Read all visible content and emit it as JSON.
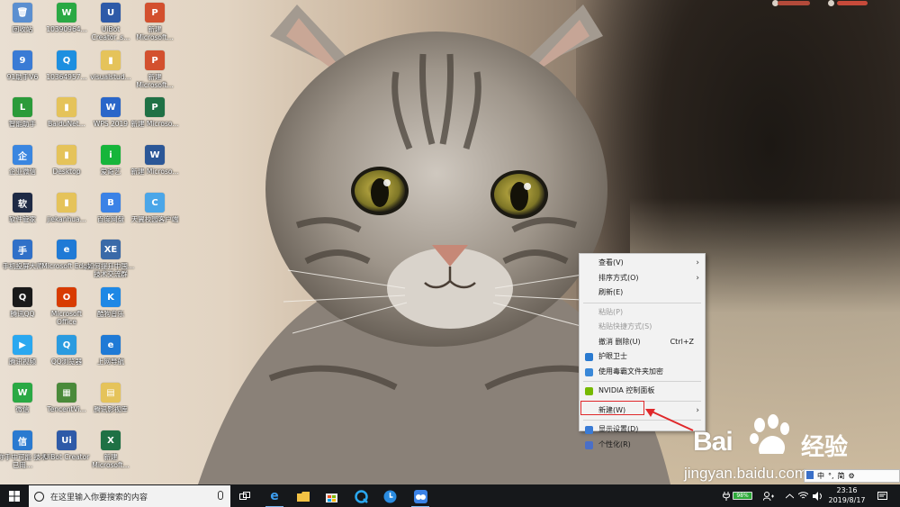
{
  "desktop_icons": [
    {
      "label": "回收站",
      "color": "#5b8fd0",
      "glyph": "🗑",
      "icon": "recycle-bin-icon"
    },
    {
      "label": "10390964...",
      "color": "#2aa944",
      "glyph": "W",
      "icon": "wechat-icon"
    },
    {
      "label": "UiBot Creator_s...",
      "color": "#2e5aa8",
      "glyph": "U",
      "icon": "uibot-icon"
    },
    {
      "label": "新建 Microsoft...",
      "color": "#d3502e",
      "glyph": "P",
      "icon": "powerpoint-file-icon"
    },
    {
      "label": "91助手V6",
      "color": "#3a7bd5",
      "glyph": "9",
      "icon": "91-assistant-icon"
    },
    {
      "label": "10364957...",
      "color": "#1d8fe0",
      "glyph": "Q",
      "icon": "qq-file-icon"
    },
    {
      "label": "visualstud...",
      "color": "#e5c35a",
      "glyph": "▮",
      "icon": "folder-icon"
    },
    {
      "label": "新建 Microsoft...",
      "color": "#d3502e",
      "glyph": "P",
      "icon": "powerpoint-file-icon"
    },
    {
      "label": "智能助手",
      "color": "#2b9b3a",
      "glyph": "L",
      "icon": "helper-icon"
    },
    {
      "label": "BaiduNet...",
      "color": "#e5c35a",
      "glyph": "▮",
      "icon": "folder-icon"
    },
    {
      "label": "WPS 2019",
      "color": "#2a66c9",
      "glyph": "W",
      "icon": "wps-icon"
    },
    {
      "label": "新建 Microso...",
      "color": "#1f7145",
      "glyph": "P",
      "icon": "publisher-file-icon"
    },
    {
      "label": "企业微信",
      "color": "#3a86e0",
      "glyph": "企",
      "icon": "wecom-icon"
    },
    {
      "label": "Desktop",
      "color": "#e5c35a",
      "glyph": "▮",
      "icon": "folder-icon"
    },
    {
      "label": "爱奇艺",
      "color": "#16b53a",
      "glyph": "i",
      "icon": "iqiyi-icon"
    },
    {
      "label": "新建 Microso...",
      "color": "#2b5797",
      "glyph": "W",
      "icon": "word-file-icon"
    },
    {
      "label": "软件管家",
      "color": "#1e2a45",
      "glyph": "软",
      "icon": "software-manager-icon"
    },
    {
      "label": "jiekanhua...",
      "color": "#e5c35a",
      "glyph": "▮",
      "icon": "folder-icon"
    },
    {
      "label": "百度网盘",
      "color": "#3b82e6",
      "glyph": "B",
      "icon": "baidu-netdisk-icon"
    },
    {
      "label": "天翼校园客户端",
      "color": "#4aa6e8",
      "glyph": "C",
      "icon": "campus-client-icon"
    },
    {
      "label": "手机投屏大师",
      "color": "#3070c8",
      "glyph": "手",
      "icon": "screen-mirror-icon"
    },
    {
      "label": "Microsoft Edge",
      "color": "#1f7ad6",
      "glyph": "e",
      "icon": "edge-icon"
    },
    {
      "label": "如何提升中国... 技术交流群",
      "color": "#3a6aa8",
      "glyph": "XE",
      "icon": "group-icon"
    },
    {
      "label": "腾讯QQ",
      "color": "#1a1a1a",
      "glyph": "Q",
      "icon": "qq-icon"
    },
    {
      "label": "Microsoft Office",
      "color": "#d83b01",
      "glyph": "O",
      "icon": "office-icon"
    },
    {
      "label": "酷狗音乐",
      "color": "#1e88e5",
      "glyph": "K",
      "icon": "kugou-icon"
    },
    {
      "label": "腾讯视频",
      "color": "#2aa8f0",
      "glyph": "▶",
      "icon": "tencent-video-icon"
    },
    {
      "label": "QQ浏览器",
      "color": "#2a9be0",
      "glyph": "Q",
      "icon": "qq-browser-icon"
    },
    {
      "label": "上网导航",
      "color": "#1f7ad6",
      "glyph": "e",
      "icon": "ie-icon"
    },
    {
      "label": "微信",
      "color": "#2aa944",
      "glyph": "W",
      "icon": "wechat-app-icon"
    },
    {
      "label": "TencentVi...",
      "color": "#4a8a3a",
      "glyph": "▦",
      "icon": "tencent-folder-icon"
    },
    {
      "label": "腾讯影视库",
      "color": "#e5c35a",
      "glyph": "▤",
      "icon": "video-library-icon"
    },
    {
      "label": "你手中可能 技术已用...",
      "color": "#2a7ad0",
      "glyph": "信",
      "icon": "doc-icon"
    },
    {
      "label": "UiBot Creator",
      "color": "#2e5aa8",
      "glyph": "Ui",
      "icon": "uibot-creator-icon"
    },
    {
      "label": "新建 Microsoft...",
      "color": "#1f7145",
      "glyph": "X",
      "icon": "excel-file-icon"
    }
  ],
  "context_menu": {
    "items": [
      {
        "label": "查看(V)",
        "submenu": true,
        "disabled": false
      },
      {
        "label": "排序方式(O)",
        "submenu": true,
        "disabled": false
      },
      {
        "label": "刷新(E)",
        "submenu": false,
        "disabled": false
      },
      {
        "sep": true
      },
      {
        "label": "粘贴(P)",
        "submenu": false,
        "disabled": true
      },
      {
        "label": "粘贴快捷方式(S)",
        "submenu": false,
        "disabled": true
      },
      {
        "label": "撤消 删除(U)",
        "shortcut": "Ctrl+Z",
        "submenu": false,
        "disabled": false
      },
      {
        "label": "护眼卫士",
        "icon_color": "#2a7ad0",
        "submenu": false,
        "disabled": false
      },
      {
        "label": "使用毒霸文件夹加密",
        "icon_color": "#3a88d8",
        "submenu": false,
        "disabled": false
      },
      {
        "sep": true
      },
      {
        "label": "NVIDIA 控制面板",
        "icon_color": "#76b900",
        "submenu": false,
        "disabled": false
      },
      {
        "sep": true
      },
      {
        "label": "新建(W)",
        "submenu": true,
        "disabled": false
      },
      {
        "sep": true
      },
      {
        "label": "显示设置(D)",
        "icon_color": "#3a7bd5",
        "submenu": false,
        "disabled": false,
        "highlighted": true
      },
      {
        "label": "个性化(R)",
        "icon_color": "#4a6fc8",
        "submenu": false,
        "disabled": false
      }
    ]
  },
  "watermark": {
    "brand": "Bai",
    "jingyan": "经验",
    "url": "jingyan.baidu.com"
  },
  "ime_bar": {
    "items": [
      "中",
      "°,",
      "简",
      "⚙"
    ]
  },
  "taskbar": {
    "search_placeholder": "在这里输入你要搜索的内容",
    "battery_level": "98%",
    "time": "23:16",
    "date": "2019/8/17"
  },
  "colors": {
    "highlight": "#e0282a",
    "taskbar": "#16181b",
    "menu_bg": "#f2f2f2"
  }
}
